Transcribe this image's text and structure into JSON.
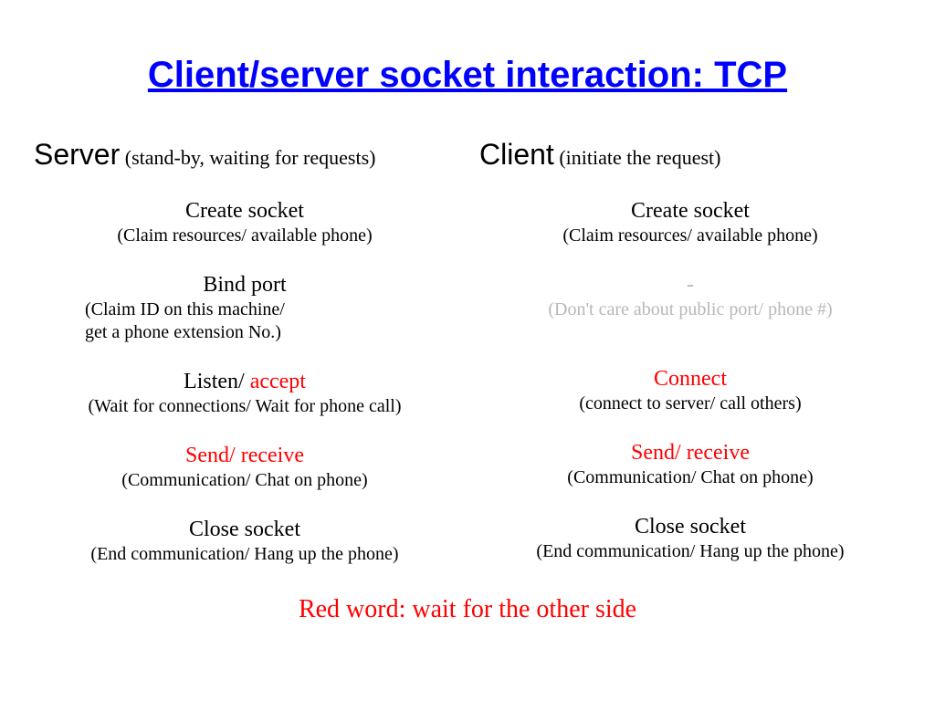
{
  "title": "Client/server socket interaction: TCP",
  "server": {
    "head_big": "Server",
    "head_sub": " (stand-by, waiting for requests)",
    "steps": {
      "s1_main": "Create socket",
      "s1_sub": "(Claim resources/ available phone)",
      "s2_main": "Bind port",
      "s2_sub1": "(Claim ID on this machine/",
      "s2_sub2": "get a phone extension No.)",
      "s3_pre": "Listen/ ",
      "s3_red": "accept",
      "s3_sub": "(Wait for connections/ Wait for phone call)",
      "s4_main": "Send/ receive",
      "s4_sub": "(Communication/ Chat on phone)",
      "s5_main": "Close socket",
      "s5_sub": "(End communication/ Hang up the phone)"
    }
  },
  "client": {
    "head_big": "Client",
    "head_sub": " (initiate the request)",
    "steps": {
      "s1_main": "Create socket",
      "s1_sub": "(Claim resources/ available phone)",
      "s2_main": "-",
      "s2_sub": "(Don't care about public port/ phone #)",
      "s3_main": "Connect",
      "s3_sub": "(connect to server/ call others)",
      "s4_main": "Send/ receive",
      "s4_sub": "(Communication/ Chat on phone)",
      "s5_main": "Close socket",
      "s5_sub": "(End communication/ Hang up the phone)"
    }
  },
  "legend": "Red word: wait for the other side"
}
